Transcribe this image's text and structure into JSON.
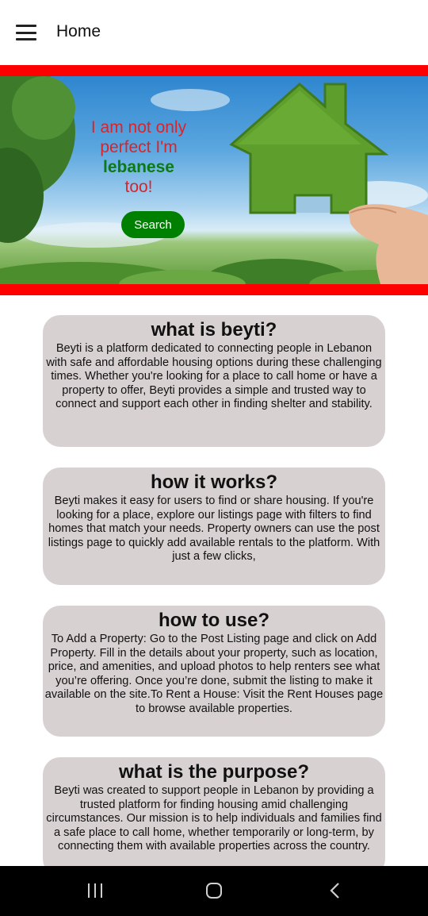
{
  "appbar": {
    "title": "Home",
    "menu_icon": "hamburger-menu-icon"
  },
  "hero": {
    "line1": "I am not only",
    "line2": "perfect I'm",
    "line3": "lebanese",
    "line4": "too!",
    "search_label": "Search",
    "colors": {
      "band": "#ff0000",
      "text_red": "#d9242b",
      "text_green": "#0c7a17",
      "button": "#008000"
    }
  },
  "cards": [
    {
      "title": "what is beyti?",
      "body": "Beyti is a platform dedicated to connecting people in Lebanon with safe and affordable housing options during these challenging times. Whether you're looking for a place to call home or have a property to offer, Beyti provides a simple and trusted way to connect and support each other in finding shelter and stability."
    },
    {
      "title": "how it works?",
      "body": "Beyti makes it easy for users to find or share housing. If you're looking for a place, explore our listings page with filters to find homes that match your needs. Property owners can use the post listings page to quickly add available rentals to the platform. With just a few clicks,"
    },
    {
      "title": "how to use?",
      "body": "To Add a Property: Go to the Post Listing page and click on Add Property. Fill in the details about your property, such as location, price, and amenities, and upload photos to help renters see what you’re offering. Once you’re done, submit the listing to make it available on the site.To Rent a House: Visit the Rent Houses page to browse available properties."
    },
    {
      "title": "what is the purpose?",
      "body": "Beyti was created to support people in Lebanon by providing a trusted platform for finding housing amid challenging circumstances. Our mission is to help individuals and families find a safe place to call home, whether temporarily or long-term, by connecting them with available properties across the country."
    }
  ],
  "card_color": "#d8d1d2",
  "system_nav": {
    "recent_icon": "recent-apps-icon",
    "home_icon": "home-circle-icon",
    "back_icon": "back-chevron-icon"
  }
}
